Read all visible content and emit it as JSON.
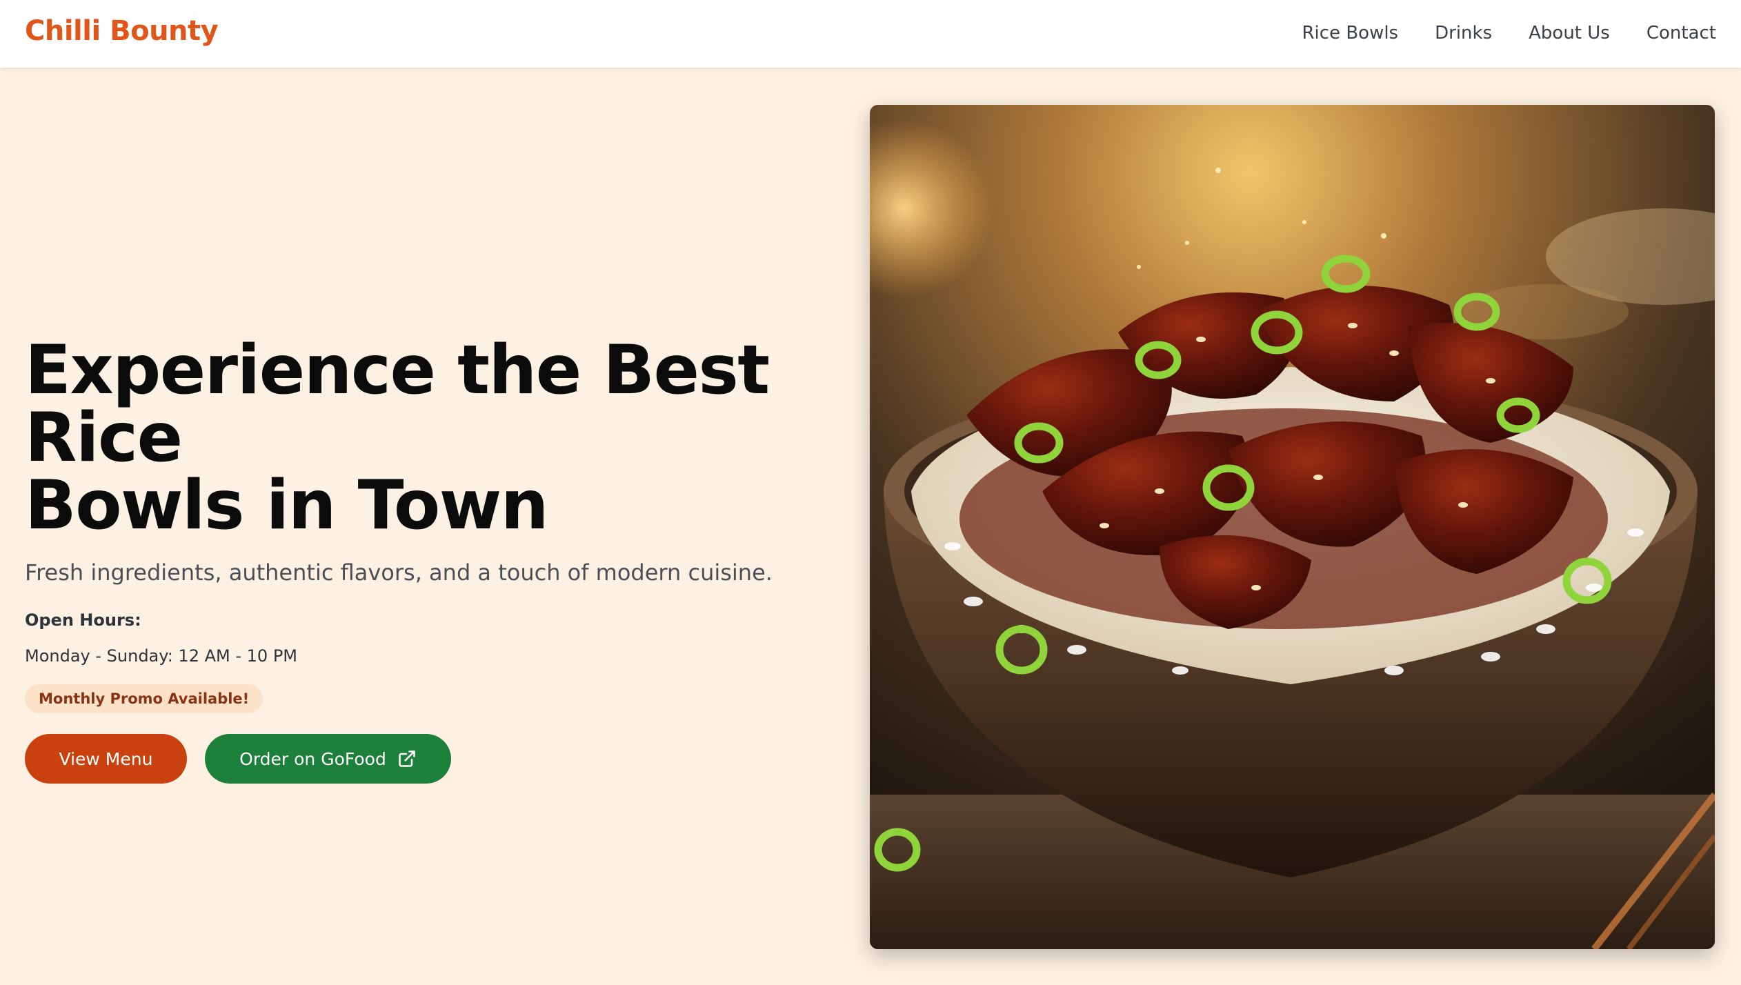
{
  "nav": {
    "brand": "Chilli Bounty",
    "links": [
      "Rice Bowls",
      "Drinks",
      "About Us",
      "Contact"
    ]
  },
  "hero": {
    "title_line1": "Experience the Best Rice",
    "title_line2": "Bowls in Town",
    "subtitle": "Fresh ingredients, authentic flavors, and a touch of modern cuisine.",
    "hours_label": "Open Hours:",
    "hours_value": "Monday - Sunday: 12 AM - 10 PM",
    "promo_badge": "Monthly Promo Available!",
    "btn_menu": "View Menu",
    "btn_gofood": "Order on GoFood",
    "btn_gofood_icon": "external-link-icon",
    "image_alt": "rice bowl with glazed beef and green onions"
  },
  "colors": {
    "brand": "#e0561a",
    "menu_button": "#c9410f",
    "gofood_button": "#1c7f3a",
    "background": "#fdf1e3",
    "promo_badge_bg": "#fbe2c8",
    "promo_badge_text": "#8a3314"
  }
}
